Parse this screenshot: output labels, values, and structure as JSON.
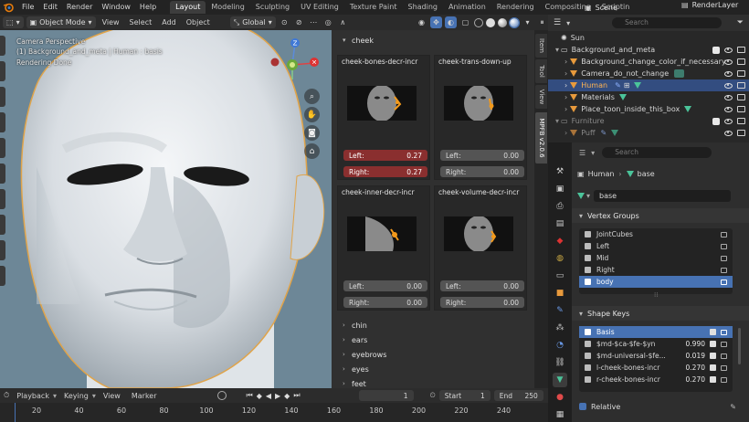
{
  "top_menu": {
    "items": [
      "File",
      "Edit",
      "Render",
      "Window",
      "Help"
    ],
    "workspaces": [
      "Layout",
      "Modeling",
      "Sculpting",
      "UV Editing",
      "Texture Paint",
      "Shading",
      "Animation",
      "Rendering",
      "Compositing",
      "Scriptin"
    ],
    "active_workspace": "Layout",
    "scene": "Scene",
    "view_layer": "RenderLayer"
  },
  "viewport_header": {
    "mode": "Object Mode",
    "menus": [
      "View",
      "Select",
      "Add",
      "Object"
    ],
    "transform_orientation": "Global"
  },
  "viewport": {
    "overlay_line1": "Camera Perspective",
    "overlay_line2": "(1) Background_and_meta | Human : basis",
    "overlay_line3": "Rendering Done",
    "gizmo": {
      "z_label": "Z"
    }
  },
  "expression_panel": {
    "category_open": "cheek",
    "cards": [
      {
        "title": "cheek-bones-decr-incr",
        "left_label": "Left:",
        "left_value": "0.27",
        "right_label": "Right:",
        "right_value": "0.27",
        "hot": true
      },
      {
        "title": "cheek-trans-down-up",
        "left_label": "Left:",
        "left_value": "0.00",
        "right_label": "Right:",
        "right_value": "0.00",
        "hot": false
      },
      {
        "title": "cheek-inner-decr-incr",
        "left_label": "Left:",
        "left_value": "0.00",
        "right_label": "Right:",
        "right_value": "0.00",
        "hot": false
      },
      {
        "title": "cheek-volume-decr-incr",
        "left_label": "Left:",
        "left_value": "0.00",
        "right_label": "Right:",
        "right_value": "0.00",
        "hot": false
      }
    ],
    "categories_closed": [
      "chin",
      "ears",
      "eyebrows",
      "eyes",
      "feet"
    ]
  },
  "side_tabs": [
    "Item",
    "Tool",
    "View",
    "MPFB v2.0.6"
  ],
  "outliner": {
    "search_placeholder": "Search",
    "rows": [
      {
        "label": "Sun",
        "type": "light"
      },
      {
        "label": "Background_and_meta",
        "type": "collection"
      },
      {
        "label": "Background_change_color_if_necessary",
        "type": "object"
      },
      {
        "label": "Camera_do_not_change",
        "type": "object"
      },
      {
        "label": "Human",
        "type": "object"
      },
      {
        "label": "Materials",
        "type": "object"
      },
      {
        "label": "Place_toon_inside_this_box",
        "type": "object"
      },
      {
        "label": "Furniture",
        "type": "collection"
      },
      {
        "label": "Puff",
        "type": "object"
      }
    ]
  },
  "properties": {
    "search_placeholder": "Search",
    "breadcrumb_object": "Human",
    "breadcrumb_data": "base",
    "mesh_name": "base",
    "vertex_groups_title": "Vertex Groups",
    "vertex_groups": [
      "JointCubes",
      "Left",
      "Mid",
      "Right",
      "body"
    ],
    "shape_keys_title": "Shape Keys",
    "shape_keys": [
      {
        "name": "Basis",
        "value": ""
      },
      {
        "name": "$md-$ca-$fe-$yn",
        "value": "0.990"
      },
      {
        "name": "$md-universal-$fe...",
        "value": "0.019"
      },
      {
        "name": "l-cheek-bones-incr",
        "value": "0.270"
      },
      {
        "name": "r-cheek-bones-incr",
        "value": "0.270"
      }
    ],
    "relative_label": "Relative"
  },
  "timeline": {
    "menus": [
      "Playback",
      "Keying",
      "View",
      "Marker"
    ],
    "current_frame": "1",
    "start_label": "Start",
    "start_value": "1",
    "end_label": "End",
    "end_value": "250",
    "ticks": [
      "20",
      "40",
      "60",
      "80",
      "100",
      "120",
      "140",
      "160",
      "180",
      "200",
      "220",
      "240"
    ]
  },
  "colors": {
    "accent": "#4772b3",
    "selected_row": "#334d80",
    "hot_field": "#8a2f2f",
    "viewport_bg": "#6d8797",
    "object_orange": "#e89a3c",
    "modifier_green": "#4bc49a"
  }
}
